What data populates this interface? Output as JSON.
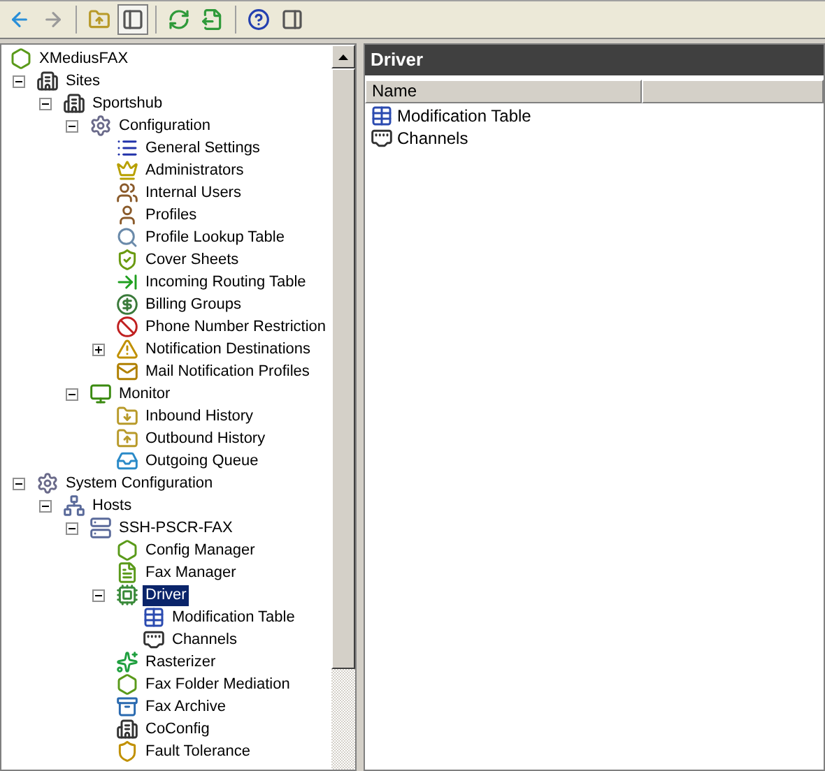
{
  "toolbar": {
    "buttons": [
      {
        "disabled": false,
        "pressed": false
      },
      {
        "disabled": true,
        "pressed": false
      },
      {
        "disabled": false,
        "pressed": false
      },
      {
        "disabled": false,
        "pressed": true
      },
      {
        "disabled": false,
        "pressed": false
      },
      {
        "disabled": false,
        "pressed": false
      },
      {
        "disabled": false,
        "pressed": false
      },
      {
        "disabled": false,
        "pressed": false
      }
    ]
  },
  "tree": [
    {
      "label": "XMediusFAX",
      "selected": false,
      "children": [
        {
          "label": "Sites",
          "selected": false,
          "expanded": true,
          "children": [
            {
              "label": "Sportshub",
              "selected": false,
              "expanded": true,
              "children": [
                {
                  "label": "Configuration",
                  "selected": false,
                  "expanded": true,
                  "children": [
                    {
                      "label": "General Settings",
                      "selected": false
                    },
                    {
                      "label": "Administrators",
                      "selected": false
                    },
                    {
                      "label": "Internal Users",
                      "selected": false
                    },
                    {
                      "label": "Profiles",
                      "selected": false
                    },
                    {
                      "label": "Profile Lookup Table",
                      "selected": false
                    },
                    {
                      "label": "Cover Sheets",
                      "selected": false
                    },
                    {
                      "label": "Incoming Routing Table",
                      "selected": false
                    },
                    {
                      "label": "Billing Groups",
                      "selected": false
                    },
                    {
                      "label": "Phone Number Restriction",
                      "selected": false
                    },
                    {
                      "label": "Notification Destinations",
                      "selected": false,
                      "expanded": false
                    },
                    {
                      "label": "Mail Notification Profiles",
                      "selected": false
                    }
                  ]
                },
                {
                  "label": "Monitor",
                  "selected": false,
                  "expanded": true,
                  "children": [
                    {
                      "label": "Inbound History",
                      "selected": false
                    },
                    {
                      "label": "Outbound History",
                      "selected": false
                    },
                    {
                      "label": "Outgoing Queue",
                      "selected": false
                    }
                  ]
                }
              ]
            }
          ]
        },
        {
          "label": "System Configuration",
          "selected": false,
          "expanded": true,
          "children": [
            {
              "label": "Hosts",
              "selected": false,
              "expanded": true,
              "children": [
                {
                  "label": "SSH-PSCR-FAX",
                  "selected": false,
                  "expanded": true,
                  "children": [
                    {
                      "label": "Config Manager",
                      "selected": false
                    },
                    {
                      "label": "Fax Manager",
                      "selected": false
                    },
                    {
                      "label": "Driver",
                      "selected": true,
                      "expanded": true,
                      "children": [
                        {
                          "label": "Modification Table",
                          "selected": false
                        },
                        {
                          "label": "Channels",
                          "selected": false
                        }
                      ]
                    },
                    {
                      "label": "Rasterizer",
                      "selected": false
                    },
                    {
                      "label": "Fax Folder Mediation",
                      "selected": false
                    },
                    {
                      "label": "Fax Archive",
                      "selected": false
                    },
                    {
                      "label": "CoConfig",
                      "selected": false
                    },
                    {
                      "label": "Fault Tolerance",
                      "selected": false
                    }
                  ]
                }
              ]
            }
          ]
        }
      ]
    }
  ],
  "detail": {
    "title": "Driver",
    "columns": [
      "Name"
    ],
    "items": [
      {
        "label": "Modification Table",
        "selected": false
      },
      {
        "label": "Channels",
        "selected": false
      }
    ]
  }
}
